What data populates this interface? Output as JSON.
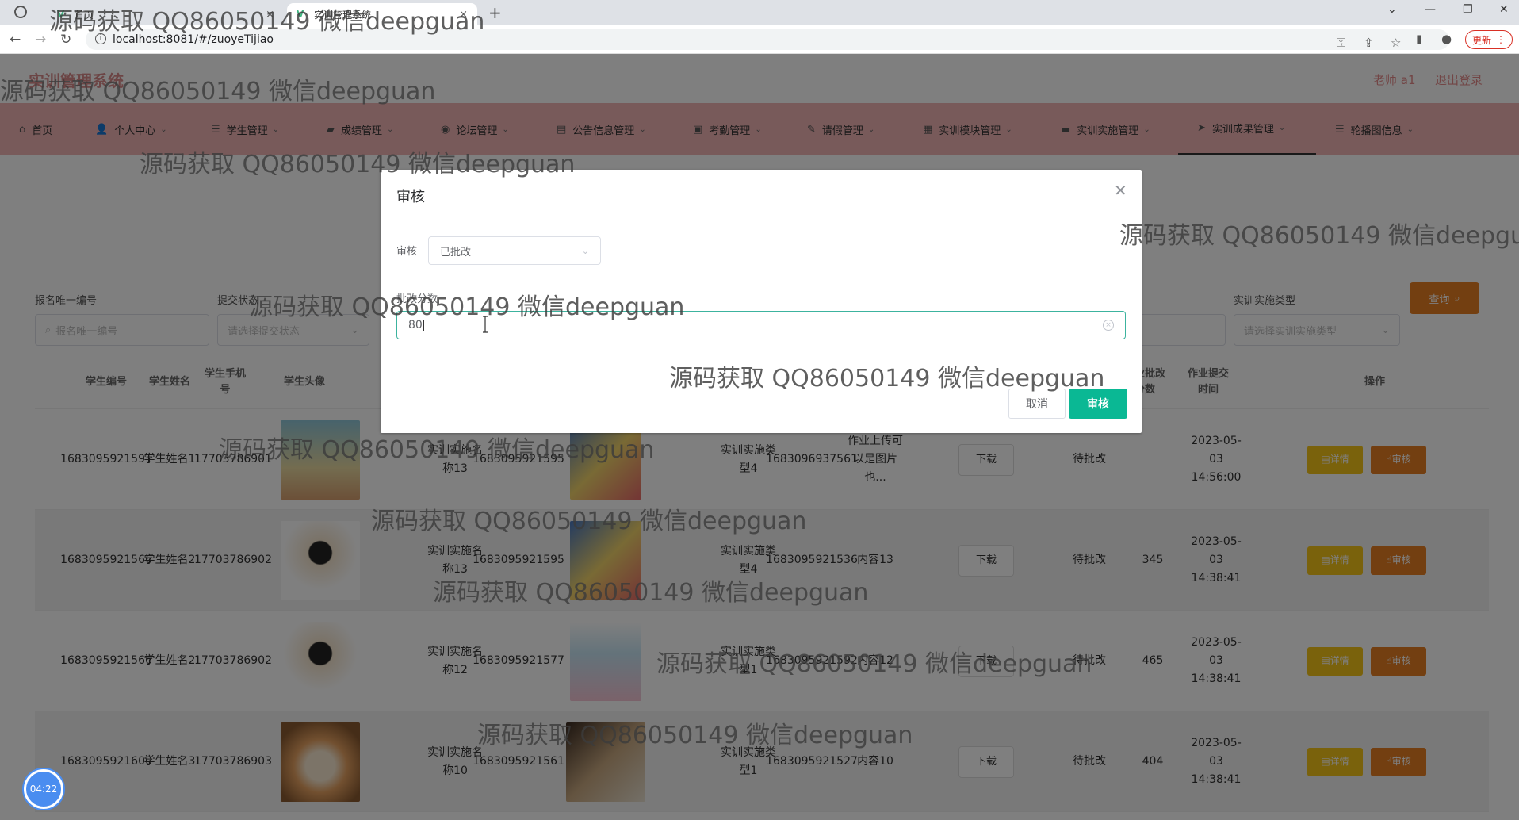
{
  "browser": {
    "tabs": [
      {
        "label": "首页",
        "close": "×"
      },
      {
        "label": "实训管理系统",
        "close": "×"
      }
    ],
    "new_tab": "+",
    "url": "localhost:8081/#/zuoyeTijiao",
    "update_label": "更新"
  },
  "header": {
    "title": "实训管理系统",
    "user": "老师 a1",
    "logout": "退出登录"
  },
  "nav": {
    "items": [
      {
        "label": "首页",
        "icon": "⌂"
      },
      {
        "label": "个人中心",
        "icon": "👤"
      },
      {
        "label": "学生管理",
        "icon": "☰"
      },
      {
        "label": "成绩管理",
        "icon": "▰"
      },
      {
        "label": "论坛管理",
        "icon": "◉"
      },
      {
        "label": "公告信息管理",
        "icon": "▤"
      },
      {
        "label": "考勤管理",
        "icon": "▣"
      },
      {
        "label": "请假管理",
        "icon": "✎"
      },
      {
        "label": "实训模块管理",
        "icon": "▦"
      },
      {
        "label": "实训实施管理",
        "icon": "▬"
      },
      {
        "label": "实训成果管理",
        "icon": "➤"
      },
      {
        "label": "轮播图信息",
        "icon": "☰"
      }
    ]
  },
  "search": {
    "fields": [
      {
        "label": "报名唯一编号",
        "placeholder": "报名唯一编号"
      },
      {
        "label": "提交状态",
        "placeholder": "请选择提交状态"
      },
      {
        "label": "实训实施类型",
        "placeholder": "请选择实训实施类型"
      }
    ],
    "button": "查询"
  },
  "table": {
    "headers": [
      "学生编号",
      "学生姓名",
      "学生手机号",
      "学生头像",
      "作业批改分数",
      "作业提交时间",
      "操作"
    ],
    "download_label": "下载",
    "detail_label": "详情",
    "audit_label": "审核",
    "rows": [
      {
        "student_no": "1683095921591",
        "name": "学生姓名1",
        "phone": "17703786901",
        "module_name": "实训实施名称13",
        "module_no": "1683095921595",
        "impl_type": "实训实施类型4",
        "impl_no": "1683096937561",
        "content": "作业上传可以是图片也...",
        "status": "待批改",
        "score": "",
        "time": "2023-05-03 14:56:00"
      },
      {
        "student_no": "1683095921566",
        "name": "学生姓名2",
        "phone": "17703786902",
        "module_name": "实训实施名称13",
        "module_no": "1683095921595",
        "impl_type": "实训实施类型4",
        "impl_no": "1683095921536",
        "content": "内容13",
        "status": "待批改",
        "score": "345",
        "time": "2023-05-03 14:38:41"
      },
      {
        "student_no": "1683095921566",
        "name": "学生姓名2",
        "phone": "17703786902",
        "module_name": "实训实施名称12",
        "module_no": "1683095921577",
        "impl_type": "实训实施类型1",
        "impl_no": "1683095921592",
        "content": "内容12",
        "status": "待批改",
        "score": "465",
        "time": "2023-05-03 14:38:41"
      },
      {
        "student_no": "1683095921600",
        "name": "学生姓名3",
        "phone": "17703786903",
        "module_name": "实训实施名称10",
        "module_no": "1683095921561",
        "impl_type": "实训实施类型1",
        "impl_no": "1683095921527",
        "content": "内容10",
        "status": "待批改",
        "score": "404",
        "time": "2023-05-03 14:38:41"
      }
    ]
  },
  "dialog": {
    "title": "审核",
    "audit_label": "审核",
    "audit_value": "已批改",
    "score_label": "批改分数",
    "score_value": "80",
    "cancel": "取消",
    "confirm": "审核"
  },
  "watermark": "源码获取 QQ86050149 微信deepguan",
  "timer": "04:22"
}
